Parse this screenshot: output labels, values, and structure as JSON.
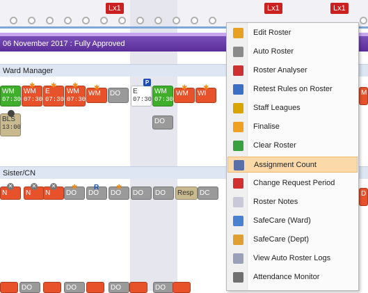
{
  "top_badges": [
    "Lx1",
    "Lx1",
    "Lx1"
  ],
  "date_bar": {
    "text": "06 November 2017 : Fully Approved"
  },
  "sections": {
    "ward_manager": "Ward Manager",
    "sister_cn": "Sister/CN"
  },
  "ward_manager_shifts": [
    {
      "code": "WM",
      "time": "07:30",
      "color": "green"
    },
    {
      "code": "WM",
      "time": "07:30",
      "color": "red"
    },
    {
      "code": "E",
      "time": "07:30",
      "color": "red"
    },
    {
      "code": "WM",
      "time": "07:30",
      "color": "red"
    },
    {
      "code": "WM",
      "time": "",
      "color": "red"
    },
    {
      "code": "DO",
      "time": "",
      "color": "grey"
    },
    {
      "code": "E",
      "time": "07:30",
      "color": "white"
    },
    {
      "code": "WM",
      "time": "07:30",
      "color": "green"
    },
    {
      "code": "WM",
      "time": "",
      "color": "red"
    },
    {
      "code": "WI",
      "time": "",
      "color": "red"
    }
  ],
  "ward_manager_row2": [
    {
      "code": "BLS",
      "time": "13:00",
      "color": "tan"
    },
    {
      "code": "DO",
      "time": "",
      "color": "grey"
    }
  ],
  "p_badge": "P",
  "r_badge": "R",
  "sister_shifts": [
    {
      "code": "N",
      "color": "red"
    },
    {
      "code": "N",
      "color": "red"
    },
    {
      "code": "N",
      "color": "red"
    },
    {
      "code": "DO",
      "color": "grey"
    },
    {
      "code": "DO",
      "color": "grey"
    },
    {
      "code": "DO",
      "color": "grey"
    },
    {
      "code": "DO",
      "color": "grey"
    },
    {
      "code": "DO",
      "color": "grey"
    },
    {
      "code": "Resp",
      "color": "tan"
    },
    {
      "code": "DC",
      "color": "grey"
    }
  ],
  "right_edge": {
    "wm": "M",
    "d": "D"
  },
  "bottom_partial": [
    "DO",
    "DO",
    "DO",
    "DO"
  ],
  "context_menu": {
    "items": [
      {
        "label": "Edit Roster",
        "icon": "edit-roster-icon",
        "color": "#e8a020"
      },
      {
        "label": "Auto Roster",
        "icon": "auto-roster-icon",
        "color": "#8a8a8a"
      },
      {
        "label": "Roster Analyser",
        "icon": "roster-analyser-icon",
        "color": "#cc3030"
      },
      {
        "label": "Retest Rules on Roster",
        "icon": "retest-rules-icon",
        "color": "#3a6fc4"
      },
      {
        "label": "Staff Leagues",
        "icon": "staff-leagues-icon",
        "color": "#d9a400"
      },
      {
        "label": "Finalise",
        "icon": "finalise-icon",
        "color": "#f0a020"
      },
      {
        "label": "Clear Roster",
        "icon": "clear-roster-icon",
        "color": "#3aa040"
      },
      {
        "label": "Assignment Count",
        "icon": "assignment-count-icon",
        "color": "#5a6fa8"
      },
      {
        "label": "Change Request Period",
        "icon": "change-request-icon",
        "color": "#d03030"
      },
      {
        "label": "Roster Notes",
        "icon": "roster-notes-icon",
        "color": "#c8c8d8"
      },
      {
        "label": "SafeCare (Ward)",
        "icon": "safecare-ward-icon",
        "color": "#4a80d0"
      },
      {
        "label": "SafeCare (Dept)",
        "icon": "safecare-dept-icon",
        "color": "#e0a030"
      },
      {
        "label": "View Auto Roster Logs",
        "icon": "auto-roster-logs-icon",
        "color": "#9aa0b8"
      },
      {
        "label": "Attendance Monitor",
        "icon": "attendance-monitor-icon",
        "color": "#707070"
      }
    ],
    "highlighted_index": 7
  }
}
